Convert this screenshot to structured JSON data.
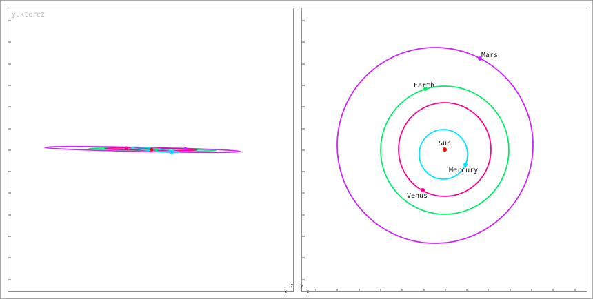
{
  "app": {
    "watermark": "yukterez"
  },
  "views": {
    "side": {
      "axis_h": "x",
      "axis_v": "z"
    },
    "top": {
      "axis_h": "x",
      "axis_v": "y"
    }
  },
  "bodies": [
    {
      "name": "Sun",
      "label": "Sun",
      "color": "#ff0000"
    },
    {
      "name": "Mercury",
      "label": "Mercury",
      "color": "#00e5ff"
    },
    {
      "name": "Venus",
      "label": "Venus",
      "color": "#ff0090"
    },
    {
      "name": "Earth",
      "label": "Earth",
      "color": "#00ee66"
    },
    {
      "name": "Mars",
      "label": "Mars",
      "color": "#cc22ff"
    }
  ],
  "legend": {
    "sun": "Sun",
    "mercury": "Mercury",
    "venus": "Venus",
    "earth": "Earth",
    "mars": "Mars"
  }
}
